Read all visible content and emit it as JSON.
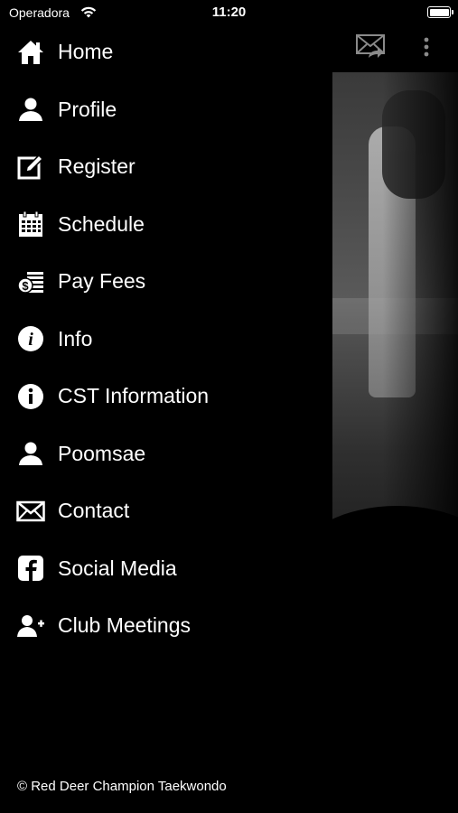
{
  "status_bar": {
    "carrier": "Operadora",
    "time": "11:20",
    "wifi_icon": "wifi-icon",
    "battery_icon": "battery-icon"
  },
  "menu": {
    "items": [
      {
        "label": "Home",
        "icon": "home-icon"
      },
      {
        "label": "Profile",
        "icon": "user-icon"
      },
      {
        "label": "Register",
        "icon": "edit-icon"
      },
      {
        "label": "Schedule",
        "icon": "calendar-icon"
      },
      {
        "label": "Pay Fees",
        "icon": "money-icon"
      },
      {
        "label": "Info",
        "icon": "info-icon"
      },
      {
        "label": "CST Information",
        "icon": "info-icon"
      },
      {
        "label": "Poomsae",
        "icon": "user-icon"
      },
      {
        "label": "Contact",
        "icon": "envelope-icon"
      },
      {
        "label": "Social Media",
        "icon": "facebook-icon"
      },
      {
        "label": "Club Meetings",
        "icon": "user-plus-icon"
      }
    ]
  },
  "top_actions": {
    "mail_icon": "mail-forward-icon",
    "more_icon": "more-vertical-icon"
  },
  "footer": {
    "text": "© Red Deer Champion Taekwondo"
  },
  "colors": {
    "background": "#000000",
    "text": "#ffffff"
  }
}
